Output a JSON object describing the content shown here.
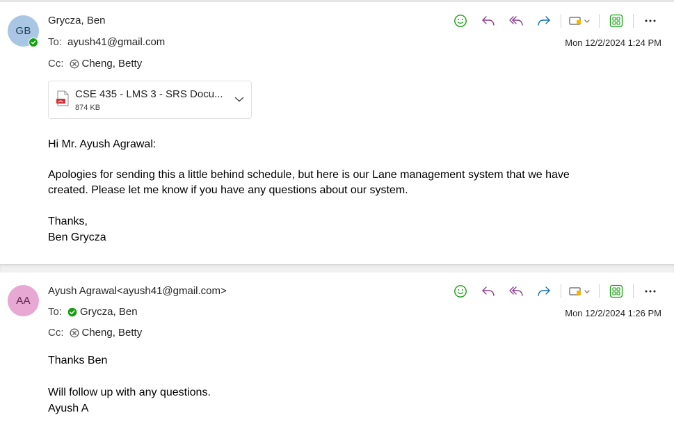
{
  "messages": [
    {
      "avatar_initials": "GB",
      "sender": "Grycza, Ben",
      "to_label": "To:",
      "to": "ayush41@gmail.com",
      "cc_label": "Cc:",
      "cc": "Cheng, Betty",
      "timestamp": "Mon 12/2/2024 1:24 PM",
      "attachment": {
        "name": "CSE 435 - LMS 3 - SRS Docu...",
        "size": "874 KB",
        "icon": "pdf-file-icon"
      },
      "body": {
        "greeting": "Hi Mr. Ayush Agrawal:",
        "para1_line1": "Apologies for sending this a little behind schedule, but here is our Lane management system that we have",
        "para1_line2": "created. Please let me know if you have any questions about our system.",
        "closing": "Thanks,",
        "signature": "Ben Grycza"
      }
    },
    {
      "avatar_initials": "AA",
      "sender": "Ayush Agrawal<ayush41@gmail.com>",
      "to_label": "To:",
      "to": "Grycza, Ben",
      "cc_label": "Cc:",
      "cc": "Cheng, Betty",
      "timestamp": "Mon 12/2/2024 1:26 PM",
      "body": {
        "line1": "Thanks Ben",
        "line2": "Will follow up with any questions.",
        "line3": "Ayush A"
      }
    }
  ],
  "toolbar_icons": [
    "emoji-icon",
    "reply-icon",
    "reply-all-icon",
    "forward-icon",
    "tag-icon",
    "apps-icon",
    "more-icon"
  ],
  "colors": {
    "accent_green": "#13a10e",
    "reply_purple": "#8a3d8f",
    "forward_blue": "#0f6cbd",
    "avatar_gb": "#a9c7e4",
    "avatar_aa": "#e8a8d4"
  }
}
